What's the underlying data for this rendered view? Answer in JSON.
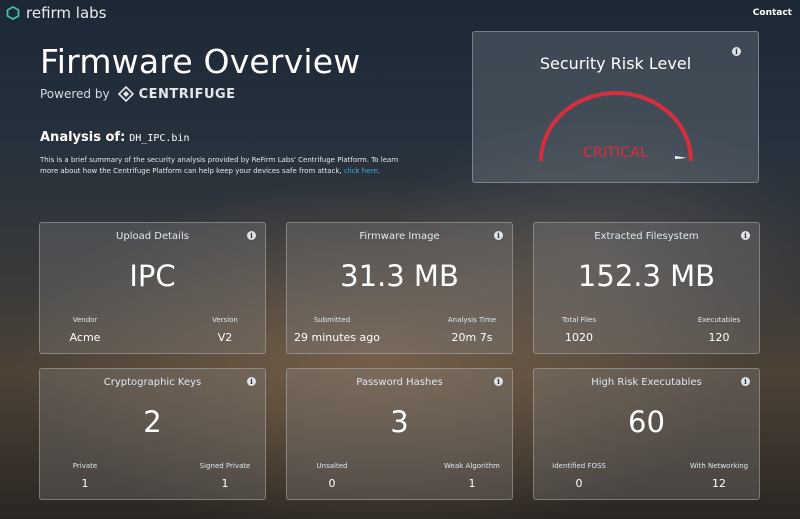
{
  "nav": {
    "brand": "refirm labs",
    "contact": "Contact"
  },
  "header": {
    "title": "Firmware Overview",
    "powered_by": "Powered by",
    "logo_text": "CENTRIFUGE",
    "analysis_label": "Analysis of:",
    "analysis_file": "DH_IPC.bin",
    "description": "This is a brief summary of the security analysis provided by ReFirm Labs' Centrifuge Platform. To learn more about how the Centrifuge Platform can help keep your devices safe from attack,",
    "description_link": "click here",
    "description_end": "."
  },
  "risk": {
    "title": "Security Risk Level",
    "level": "CRITICAL",
    "gauge_fraction": 0.97,
    "color": "#d82d3c"
  },
  "cards": [
    {
      "title": "Upload Details",
      "value": "IPC",
      "left_label": "Vendor",
      "left_value": "Acme",
      "right_label": "Version",
      "right_value": "V2"
    },
    {
      "title": "Firmware Image",
      "value": "31.3 MB",
      "left_label": "Submitted",
      "left_value": "29 minutes ago",
      "right_label": "Analysis Time",
      "right_value": "20m 7s"
    },
    {
      "title": "Extracted Filesystem",
      "value": "152.3 MB",
      "left_label": "Total Files",
      "left_value": "1020",
      "right_label": "Executables",
      "right_value": "120"
    },
    {
      "title": "Cryptographic Keys",
      "value": "2",
      "left_label": "Private",
      "left_value": "1",
      "right_label": "Signed Private",
      "right_value": "1"
    },
    {
      "title": "Password Hashes",
      "value": "3",
      "left_label": "Unsalted",
      "left_value": "0",
      "right_label": "Weak Algorithm",
      "right_value": "1"
    },
    {
      "title": "High Risk Executables",
      "value": "60",
      "left_label": "Identified FOSS",
      "left_value": "0",
      "right_label": "With Networking",
      "right_value": "12"
    }
  ]
}
